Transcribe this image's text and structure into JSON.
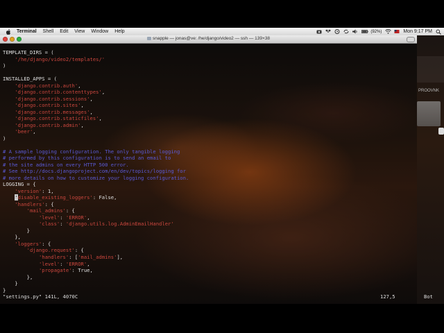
{
  "menubar": {
    "app_name": "Terminal",
    "menus": [
      "Shell",
      "Edit",
      "View",
      "Window",
      "Help"
    ],
    "battery": "(92%)",
    "clock": "Mon 9:17 PM"
  },
  "window": {
    "title": "snapple — jonas@ve: /he/django/video2 — ssh — 139×38"
  },
  "desktop": {
    "drive_label": "PROOVNK"
  },
  "code_lines": [
    [
      {
        "t": "TEMPLATE_DIRS = ("
      }
    ],
    [
      {
        "t": "    "
      },
      {
        "t": "'/he/django/video2/templates/'",
        "k": "s"
      }
    ],
    [
      {
        "t": ")"
      }
    ],
    [
      {
        "t": ""
      }
    ],
    [
      {
        "t": "INSTALLED_APPS = ("
      }
    ],
    [
      {
        "t": "    "
      },
      {
        "t": "'django.contrib.auth'",
        "k": "s"
      },
      {
        "t": ","
      }
    ],
    [
      {
        "t": "    "
      },
      {
        "t": "'django.contrib.contenttypes'",
        "k": "s"
      },
      {
        "t": ","
      }
    ],
    [
      {
        "t": "    "
      },
      {
        "t": "'django.contrib.sessions'",
        "k": "s"
      },
      {
        "t": ","
      }
    ],
    [
      {
        "t": "    "
      },
      {
        "t": "'django.contrib.sites'",
        "k": "s"
      },
      {
        "t": ","
      }
    ],
    [
      {
        "t": "    "
      },
      {
        "t": "'django.contrib.messages'",
        "k": "s"
      },
      {
        "t": ","
      }
    ],
    [
      {
        "t": "    "
      },
      {
        "t": "'django.contrib.staticfiles'",
        "k": "s"
      },
      {
        "t": ","
      }
    ],
    [
      {
        "t": "    "
      },
      {
        "t": "'django.contrib.admin'",
        "k": "s"
      },
      {
        "t": ","
      }
    ],
    [
      {
        "t": "    "
      },
      {
        "t": "'beer'",
        "k": "s"
      },
      {
        "t": ","
      }
    ],
    [
      {
        "t": ")"
      }
    ],
    [
      {
        "t": ""
      }
    ],
    [
      {
        "t": "# A sample logging configuration. The only tangible logging",
        "k": "c"
      }
    ],
    [
      {
        "t": "# performed by this configuration is to send an email to",
        "k": "c"
      }
    ],
    [
      {
        "t": "# the site admins on every HTTP 500 error.",
        "k": "c"
      }
    ],
    [
      {
        "t": "# See http://docs.djangoproject.com/en/dev/topics/logging for",
        "k": "c"
      }
    ],
    [
      {
        "t": "# more details on how to customize your logging configuration.",
        "k": "c"
      }
    ],
    [
      {
        "t": "LOGGING = {"
      }
    ],
    [
      {
        "t": "    "
      },
      {
        "t": "'version'",
        "k": "s"
      },
      {
        "t": ": 1,"
      }
    ],
    [
      {
        "t": "    "
      },
      {
        "t": "'",
        "k": "cur"
      },
      {
        "t": "disable_existing_loggers'",
        "k": "s"
      },
      {
        "t": ": False,"
      }
    ],
    [
      {
        "t": "    "
      },
      {
        "t": "'handlers'",
        "k": "s"
      },
      {
        "t": ": {"
      }
    ],
    [
      {
        "t": "        "
      },
      {
        "t": "'mail_admins'",
        "k": "s"
      },
      {
        "t": ": {"
      }
    ],
    [
      {
        "t": "            "
      },
      {
        "t": "'level'",
        "k": "s"
      },
      {
        "t": ": "
      },
      {
        "t": "'ERROR'",
        "k": "s"
      },
      {
        "t": ","
      }
    ],
    [
      {
        "t": "            "
      },
      {
        "t": "'class'",
        "k": "s"
      },
      {
        "t": ": "
      },
      {
        "t": "'django.utils.log.AdminEmailHandler'",
        "k": "s"
      }
    ],
    [
      {
        "t": "        }"
      }
    ],
    [
      {
        "t": "    },"
      }
    ],
    [
      {
        "t": "    "
      },
      {
        "t": "'loggers'",
        "k": "s"
      },
      {
        "t": ": {"
      }
    ],
    [
      {
        "t": "        "
      },
      {
        "t": "'django.request'",
        "k": "s"
      },
      {
        "t": ": {"
      }
    ],
    [
      {
        "t": "            "
      },
      {
        "t": "'handlers'",
        "k": "s"
      },
      {
        "t": ": ["
      },
      {
        "t": "'mail_admins'",
        "k": "s"
      },
      {
        "t": "],"
      }
    ],
    [
      {
        "t": "            "
      },
      {
        "t": "'level'",
        "k": "s"
      },
      {
        "t": ": "
      },
      {
        "t": "'ERROR'",
        "k": "s"
      },
      {
        "t": ","
      }
    ],
    [
      {
        "t": "            "
      },
      {
        "t": "'propagate'",
        "k": "s"
      },
      {
        "t": ": True,"
      }
    ],
    [
      {
        "t": "        },"
      }
    ],
    [
      {
        "t": "    }"
      }
    ],
    [
      {
        "t": "}"
      }
    ]
  ],
  "status": {
    "file_info": "\"settings.py\" 141L, 4070C",
    "position": "127,5",
    "scroll": "Bot"
  }
}
